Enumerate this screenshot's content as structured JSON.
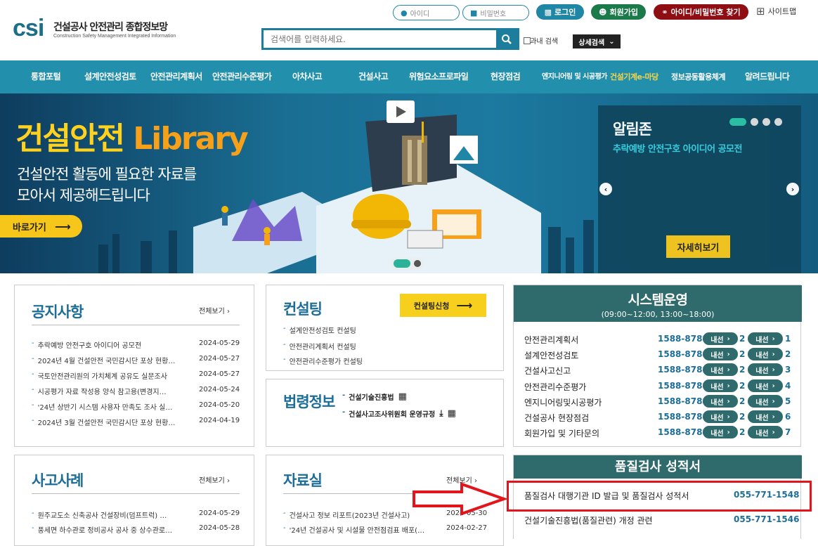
{
  "logo": {
    "mark": "csi",
    "title": "건설공사 안전관리 종합정보망",
    "subtitle": "Construction Safety Management Integrated Information"
  },
  "login": {
    "id_placeholder": "아이디",
    "pw_placeholder": "비밀번호",
    "login": "로그인",
    "join": "회원가입",
    "find": "아이디/비밀번호 찾기",
    "sitemap": "사이트맵"
  },
  "search": {
    "placeholder": "검색어를 입력하세요.",
    "in_result": "결과내 검색",
    "detail": "상세검색"
  },
  "nav": [
    "통합포털",
    "설계안전성검토",
    "안전관리계획서",
    "안전관리수준평가",
    "아차사고",
    "건설사고",
    "위험요소프로파일",
    "현장점검",
    "엔지니어링 및 시공평가",
    "건설기계e-마당",
    "정보공동활용체계",
    "알려드립니다"
  ],
  "hero": {
    "title_a": "건설안전",
    "title_b": "Library",
    "sub1": "건설안전 활동에 필요한 자료를",
    "sub2": "모아서 제공해드립니다",
    "go": "바로가기"
  },
  "notice_zone": {
    "title": "알림존",
    "text": "추락예방 안전구호 아이디어 공모전",
    "more": "자세히보기"
  },
  "notices": {
    "title": "공지사항",
    "all": "전체보기",
    "items": [
      {
        "t": "추락예방 안전구호 아이디어 공모전",
        "d": "2024-05-29"
      },
      {
        "t": "2024년 4월 건설안전 국민감시단 포상 현황…",
        "d": "2024-05-27"
      },
      {
        "t": "국토안전관리원의 가치체계 공유도 실문조사",
        "d": "2024-05-27"
      },
      {
        "t": "시공평가 자료 작성용 양식 참고용(변경지…",
        "d": "2024-05-24"
      },
      {
        "t": "'24년 상반기 시스템 사용자 만족도 조사 실…",
        "d": "2024-05-20"
      },
      {
        "t": "2024년 3월 건설안전 국민감시단 포상 현황…",
        "d": "2024-04-19"
      }
    ]
  },
  "consult": {
    "title": "컨설팅",
    "apply": "컨설팅신청",
    "items": [
      "설계안전성검토 컨설팅",
      "안전관리계획서 컨설팅",
      "안전관리수준평가 컨설팅"
    ]
  },
  "law": {
    "title": "법령정보",
    "items": [
      "건설기술진흥법",
      "건설사고조사위원회 운영규정"
    ]
  },
  "accidents": {
    "title": "사고사례",
    "all": "전체보기",
    "items": [
      {
        "t": "원주교도소 신축공사 건설장비(덤프트럭) …",
        "d": "2024-05-29"
      },
      {
        "t": "풍세면 하수관로 정비공사 공사 중 상수관로…",
        "d": "2024-05-28"
      }
    ]
  },
  "library": {
    "title": "자료실",
    "all": "전체보기",
    "items": [
      {
        "t": "건설사고 정보 리포트(2023년 건설사고)",
        "d": "2024-05-30"
      },
      {
        "t": "'24년 건설공사 및 시설물 안전점검표 배포(…",
        "d": "2024-02-27"
      }
    ]
  },
  "system": {
    "title": "시스템운영",
    "hours": "(09:00~12:00, 13:00~18:00)",
    "ext": "내선",
    "rows": [
      {
        "n": "안전관리계획서",
        "p": "1588-8788",
        "a": "2",
        "b": "1"
      },
      {
        "n": "설계안전성검토",
        "p": "1588-8788",
        "a": "2",
        "b": "2"
      },
      {
        "n": "건설사고신고",
        "p": "1588-8788",
        "a": "2",
        "b": "3"
      },
      {
        "n": "안전관리수준평가",
        "p": "1588-8788",
        "a": "2",
        "b": "4"
      },
      {
        "n": "엔지니어링및시공평가",
        "p": "1588-8788",
        "a": "2",
        "b": "5"
      },
      {
        "n": "건설공사 현장점검",
        "p": "1588-8788",
        "a": "2",
        "b": "6"
      },
      {
        "n": "회원가입 및 기타문의",
        "p": "1588-8788",
        "a": "2",
        "b": "7"
      }
    ]
  },
  "quality": {
    "title": "품질검사 성적서",
    "rows": [
      {
        "n": "품질검사 대행기관 ID 발급 및 품질검사 성적서",
        "p": "055-771-1548"
      },
      {
        "n": "건설기술진흥법(품질관련) 개정 관련",
        "p": "055-771-1546"
      }
    ]
  },
  "colors": {
    "nav": "#2290ac",
    "accent": "#f7c61b",
    "teal_header": "#2f6a6c",
    "highlight": "#e3151c"
  }
}
